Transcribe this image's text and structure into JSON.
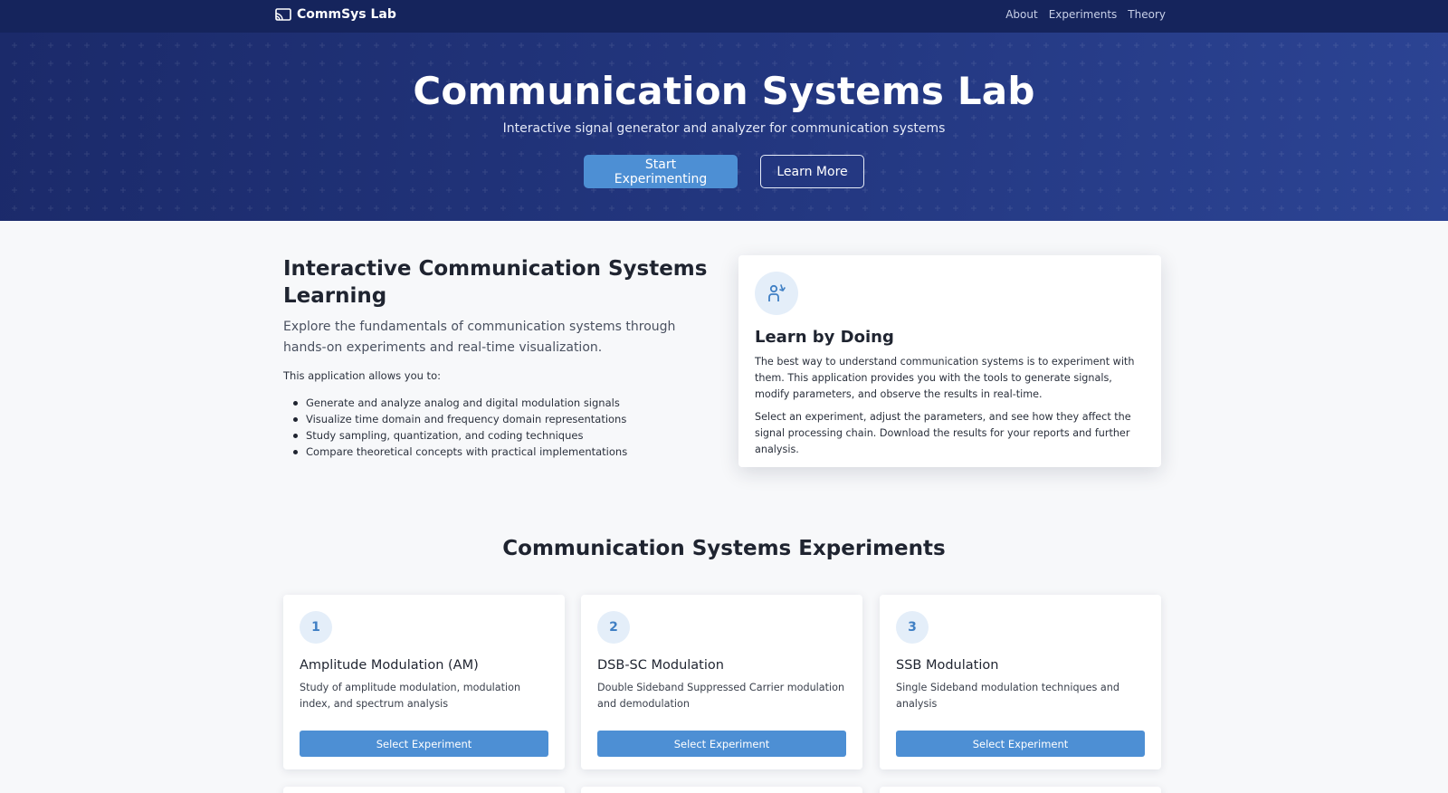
{
  "nav": {
    "brand": "CommSys Lab",
    "brand_icon": "cast-icon",
    "links": [
      "About",
      "Experiments",
      "Theory"
    ]
  },
  "hero": {
    "title": "Communication Systems Lab",
    "subtitle": "Interactive signal generator and analyzer for communication systems",
    "primary_button": "Start Experimenting",
    "secondary_button": "Learn More"
  },
  "intro": {
    "title": "Interactive Communication Systems Learning",
    "lead": "Explore the fundamentals of communication systems through hands-on experiments and real-time visualization.",
    "allows": "This application allows you to:",
    "items": [
      "Generate and analyze analog and digital modulation signals",
      "Visualize time domain and frequency domain representations",
      "Study sampling, quantization, and coding techniques",
      "Compare theoretical concepts with practical implementations"
    ]
  },
  "learn_card": {
    "icon": "person-learning-icon",
    "title": "Learn by Doing",
    "p1": "The best way to understand communication systems is to experiment with them. This application provides you with the tools to generate signals, modify parameters, and observe the results in real-time.",
    "p2": "Select an experiment, adjust the parameters, and see how they affect the signal processing chain. Download the results for your reports and further analysis."
  },
  "experiments": {
    "heading": "Communication Systems Experiments",
    "items": [
      {
        "number": "1",
        "title": "Amplitude Modulation (AM)",
        "description": "Study of amplitude modulation, modulation index, and spectrum analysis",
        "button": "Select Experiment"
      },
      {
        "number": "2",
        "title": "DSB-SC Modulation",
        "description": "Double Sideband Suppressed Carrier modulation and demodulation",
        "button": "Select Experiment"
      },
      {
        "number": "3",
        "title": "SSB Modulation",
        "description": "Single Sideband modulation techniques and analysis",
        "button": "Select Experiment"
      }
    ]
  },
  "colors": {
    "nav_bg": "#15245c",
    "hero_bg": "#233780",
    "accent": "#4d8fd4",
    "icon_circle": "#e4eef9"
  }
}
